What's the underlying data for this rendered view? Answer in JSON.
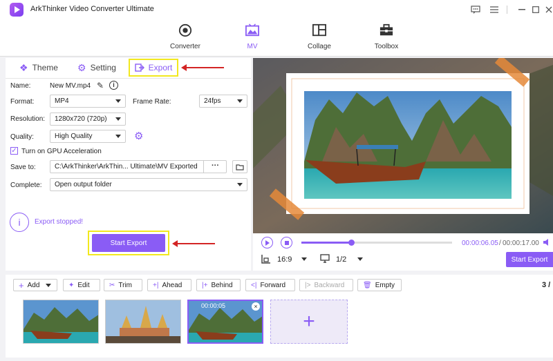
{
  "app": {
    "title": "ArkThinker Video Converter Ultimate"
  },
  "nav": {
    "tabs": [
      {
        "label": "Converter",
        "icon": "converter-icon"
      },
      {
        "label": "MV",
        "icon": "mv-icon"
      },
      {
        "label": "Collage",
        "icon": "collage-icon"
      },
      {
        "label": "Toolbox",
        "icon": "toolbox-icon"
      }
    ],
    "active": "MV"
  },
  "panel": {
    "tabs": {
      "theme": "Theme",
      "setting": "Setting",
      "export": "Export"
    }
  },
  "form": {
    "name_label": "Name:",
    "name_value": "New MV.mp4",
    "format_label": "Format:",
    "format_value": "MP4",
    "framerate_label": "Frame Rate:",
    "framerate_value": "24fps",
    "resolution_label": "Resolution:",
    "resolution_value": "1280x720 (720p)",
    "quality_label": "Quality:",
    "quality_value": "High Quality",
    "gpu_label": "Turn on GPU Acceleration",
    "gpu_checked": true,
    "saveto_label": "Save to:",
    "saveto_value": "C:\\ArkThinker\\ArkThin... Ultimate\\MV Exported",
    "saveto_more": "···",
    "complete_label": "Complete:",
    "complete_value": "Open output folder"
  },
  "status": {
    "text": "Export stopped!"
  },
  "actions": {
    "start_export": "Start Export",
    "start_export_small": "Start Export"
  },
  "player": {
    "time_current": "00:00:06.05",
    "time_sep": "/",
    "time_total": "00:00:17.00",
    "progress": 0.33,
    "aspect": "16:9",
    "page": "1/2"
  },
  "toolbar": {
    "add": "Add",
    "edit": "Edit",
    "trim": "Trim",
    "ahead": "Ahead",
    "behind": "Behind",
    "forward": "Forward",
    "backward": "Backward",
    "empty": "Empty",
    "count": "3 /"
  },
  "clips": [
    {
      "time": ""
    },
    {
      "time": ""
    },
    {
      "time": "00:00:05"
    }
  ],
  "colors": {
    "accent": "#8a5cf5",
    "highlight": "#f2e81e",
    "arrow": "#d32424"
  }
}
